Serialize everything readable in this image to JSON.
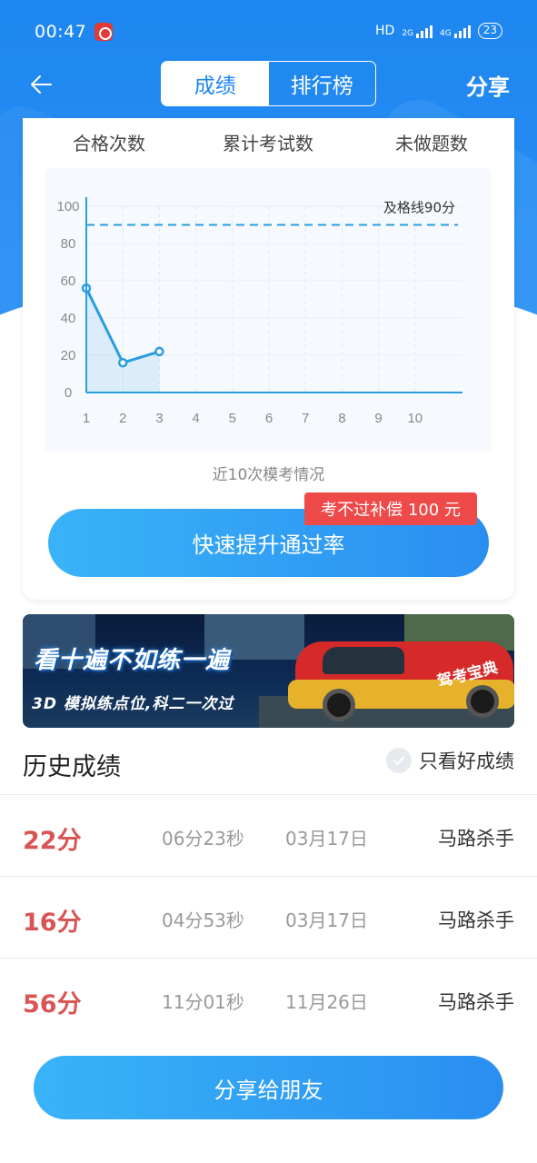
{
  "status": {
    "time": "00:47",
    "hd": "HD",
    "sig1": "2G",
    "sig2": "4G",
    "battery": "23"
  },
  "nav": {
    "back_icon": "arrow-left-icon",
    "tabs": [
      {
        "label": "成绩",
        "active": true
      },
      {
        "label": "排行榜",
        "active": false
      }
    ],
    "share_label": "分享"
  },
  "stats": [
    {
      "label": "合格次数"
    },
    {
      "label": "累计考试数"
    },
    {
      "label": "未做题数"
    }
  ],
  "chart_data": {
    "type": "line",
    "title": "",
    "xlabel": "",
    "ylabel": "",
    "x": [
      1,
      2,
      3,
      4,
      5,
      6,
      7,
      8,
      9,
      10
    ],
    "x_ticks": [
      "1",
      "2",
      "3",
      "4",
      "5",
      "6",
      "7",
      "8",
      "9",
      "10"
    ],
    "y_ticks": [
      "0",
      "20",
      "40",
      "60",
      "80",
      "100"
    ],
    "ylim": [
      0,
      100
    ],
    "series": [
      {
        "values": [
          56,
          16,
          22
        ],
        "color": "#2a9de0"
      }
    ],
    "threshold": {
      "value": 90,
      "label": "及格线90分",
      "color": "#2a9de0"
    },
    "grid": true
  },
  "chart_caption": "近10次模考情况",
  "cta": {
    "label": "快速提升通过率",
    "badge": "考不过补偿 100 元"
  },
  "banner": {
    "headline": "看十遍不如练一遍",
    "subline": "3D 模拟练点位,科二一次过",
    "car_text": "驾考宝典"
  },
  "history": {
    "title": "历史成绩",
    "filter_label": "只看好成绩",
    "rows": [
      {
        "score": "22分",
        "duration": "06分23秒",
        "date": "03月17日",
        "user": "马路杀手"
      },
      {
        "score": "16分",
        "duration": "04分53秒",
        "date": "03月17日",
        "user": "马路杀手"
      },
      {
        "score": "56分",
        "duration": "11分01秒",
        "date": "11月26日",
        "user": "马路杀手"
      }
    ]
  },
  "share_button": "分享给朋友",
  "colors": {
    "primary": "#1e86f0",
    "score_red": "#d95454",
    "badge_red": "#ef4a4a"
  }
}
